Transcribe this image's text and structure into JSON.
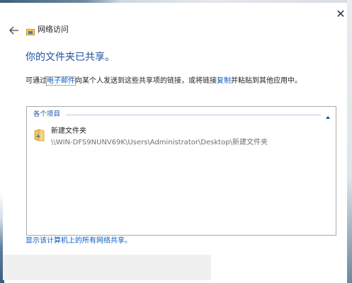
{
  "window": {
    "title": "网络访问",
    "close_symbol": "✕"
  },
  "main": {
    "heading": "你的文件夹已共享。",
    "instruction_prefix": "可通过",
    "email_link": "电子邮件",
    "instruction_middle": "向某个人发送到这些共享项的链接，或将链接",
    "copy_link": "复制",
    "instruction_suffix": "并粘贴到其他应用中。"
  },
  "items_panel": {
    "header": "各个项目",
    "items": [
      {
        "name": "新建文件夹",
        "path": "\\\\WIN-DFS9NUNV69K\\Users\\Administrator\\Desktop\\新建文件夹",
        "icon": "shared-folder-icon"
      }
    ]
  },
  "footer": {
    "link": "显示该计算机上的所有网络共享。"
  },
  "icons": {
    "back": "arrow-left-icon",
    "close": "close-icon",
    "collapse": "chevron-up-icon",
    "title": "network-share-icon"
  },
  "colors": {
    "heading": "#1e4fa3",
    "link": "#0b5cc4",
    "folder": "#f2c45a"
  }
}
